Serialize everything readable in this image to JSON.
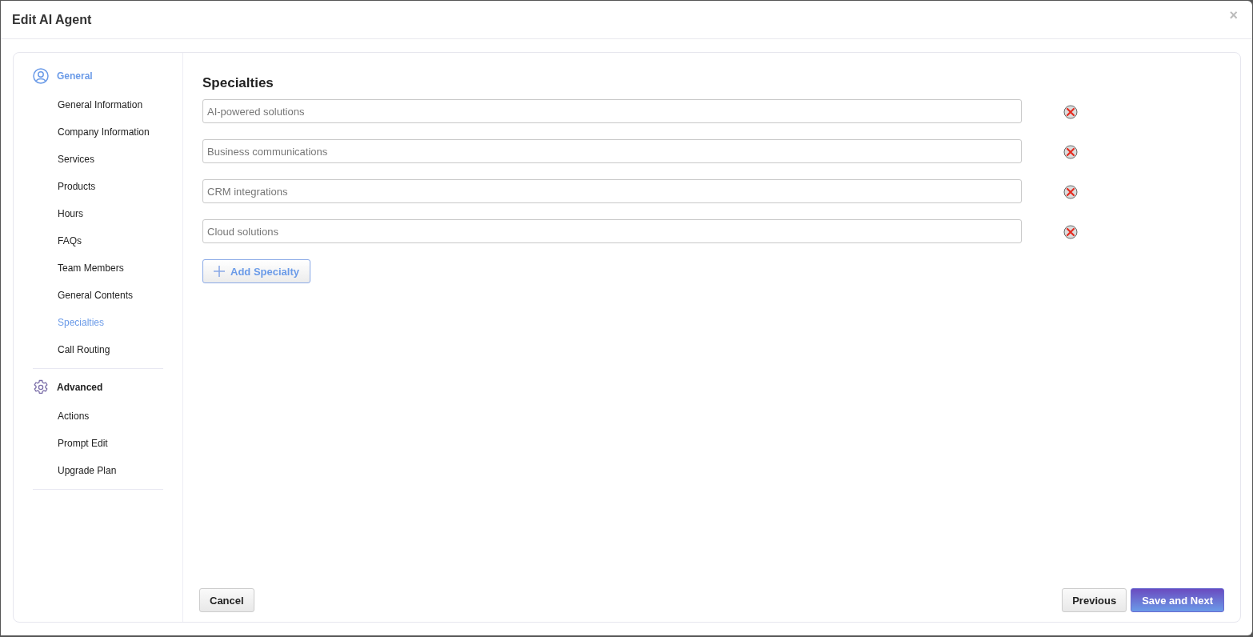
{
  "dialog": {
    "title": "Edit AI Agent",
    "close": "×"
  },
  "sidebar": {
    "groups": [
      {
        "label": "General",
        "kind": "person",
        "selected": true,
        "items": [
          {
            "label": "General Information",
            "selected": false
          },
          {
            "label": "Company Information",
            "selected": false
          },
          {
            "label": "Services",
            "selected": false
          },
          {
            "label": "Products",
            "selected": false
          },
          {
            "label": "Hours",
            "selected": false
          },
          {
            "label": "FAQs",
            "selected": false
          },
          {
            "label": "Team Members",
            "selected": false
          },
          {
            "label": "General Contents",
            "selected": false
          },
          {
            "label": "Specialties",
            "selected": true
          },
          {
            "label": "Call Routing",
            "selected": false
          }
        ]
      },
      {
        "label": "Advanced",
        "kind": "settings",
        "selected": false,
        "items": [
          {
            "label": "Actions",
            "selected": false
          },
          {
            "label": "Prompt Edit",
            "selected": false
          },
          {
            "label": "Upgrade Plan",
            "selected": false
          }
        ]
      }
    ]
  },
  "section": {
    "title": "Specialties",
    "entries": [
      "AI-powered solutions",
      "Business communications",
      "CRM integrations",
      "Cloud solutions"
    ],
    "add_button": "Add Specialty"
  },
  "footer": {
    "cancel": "Cancel",
    "previous": "Previous",
    "next": "Save and Next"
  }
}
